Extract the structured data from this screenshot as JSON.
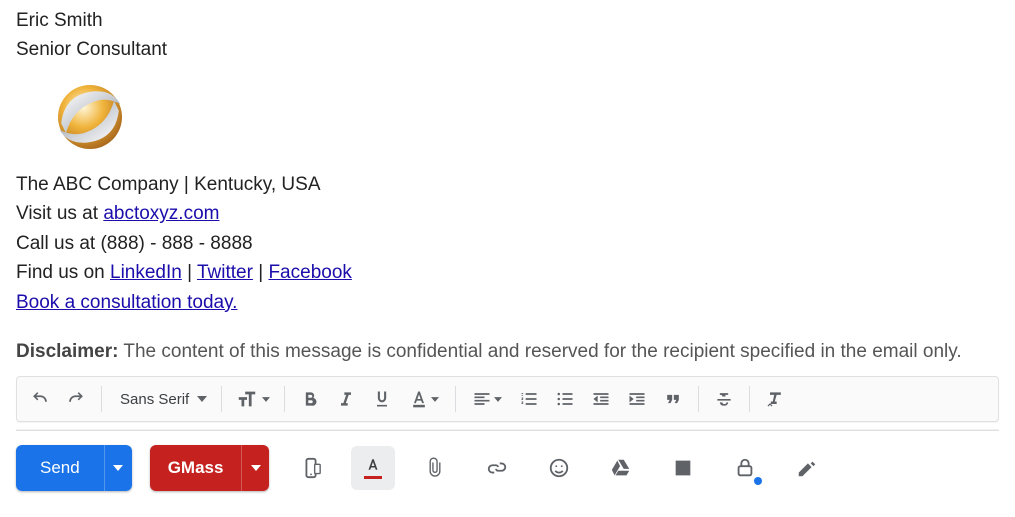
{
  "signature": {
    "name": "Eric Smith",
    "title": "Senior Consultant",
    "company_line": "The ABC Company | Kentucky, USA",
    "visit_prefix": "Visit us at ",
    "visit_link": "abctoxyz.com",
    "call_line": "Call us at (888) - 888 - 8888",
    "find_prefix": "Find us on ",
    "sep": " | ",
    "linkedin": "LinkedIn",
    "twitter": "Twitter",
    "facebook": "Facebook",
    "book_link": "Book a consultation today."
  },
  "disclaimer": {
    "label": "Disclaimer:",
    "text": " The content of this message is confidential and reserved for the recipient specified in the email only."
  },
  "format_toolbar": {
    "font": "Sans Serif"
  },
  "actions": {
    "send": "Send",
    "gmass": "GMass"
  }
}
